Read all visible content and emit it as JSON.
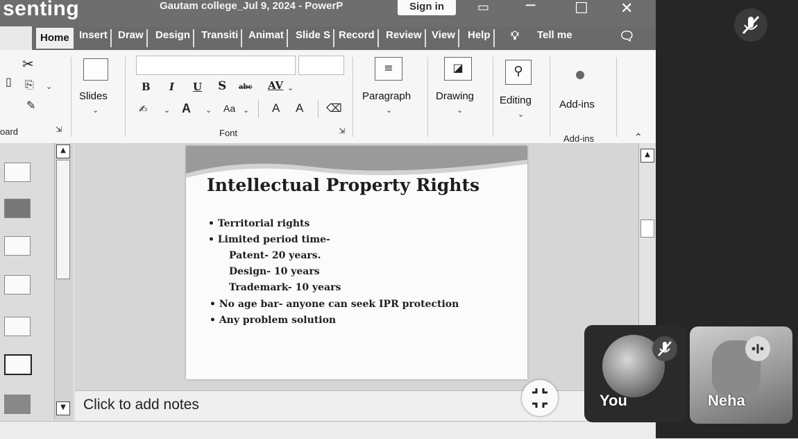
{
  "window": {
    "presenting_label": "senting",
    "doc_title": "Gautam college_Jul 9, 2024 - PowerP",
    "sign_in": "Sign in"
  },
  "tabs": [
    "Home",
    "Insert",
    "Draw",
    "Design",
    "Transiti",
    "Animat",
    "Slide S",
    "Record",
    "Review",
    "View",
    "Help",
    "Tell me"
  ],
  "ribbon": {
    "clipboard_label": "oard",
    "slides_label": "Slides",
    "font": {
      "group_label": "Font",
      "bold": "B",
      "italic": "I",
      "underline": "U",
      "strike": "S",
      "abc": "abc",
      "av": "AV",
      "font_color": "A",
      "change_case": "Aa",
      "grow": "A",
      "shrink": "A"
    },
    "paragraph_label": "Paragraph",
    "drawing_label": "Drawing",
    "editing_label": "Editing",
    "addins_button": "Add-ins",
    "addins_group": "Add-ins"
  },
  "slide": {
    "title": "Intellectual Property Rights",
    "bullets": [
      "• Territorial rights",
      "• Limited period time-",
      "Patent- 20 years.",
      "Design- 10 years",
      "Trademark- 10 years",
      "• No age bar- anyone can seek IPR protection",
      "• Any problem solution"
    ]
  },
  "notes": {
    "placeholder": "Click to add notes"
  },
  "meet": {
    "you_label": "You",
    "neha_label": "Neha"
  },
  "icons": {
    "cut": "scissors-icon",
    "copy": "copy-icon",
    "format_painter": "format-painter-icon",
    "slides": "slides-icon",
    "paragraph": "paragraph-icon",
    "drawing": "drawing-icon",
    "editing": "search-icon",
    "addins": "addins-icon",
    "lightbulb": "lightbulb-icon",
    "comments": "comment-icon",
    "mic_off": "mic-off-icon",
    "shrink": "collapse-icon"
  }
}
